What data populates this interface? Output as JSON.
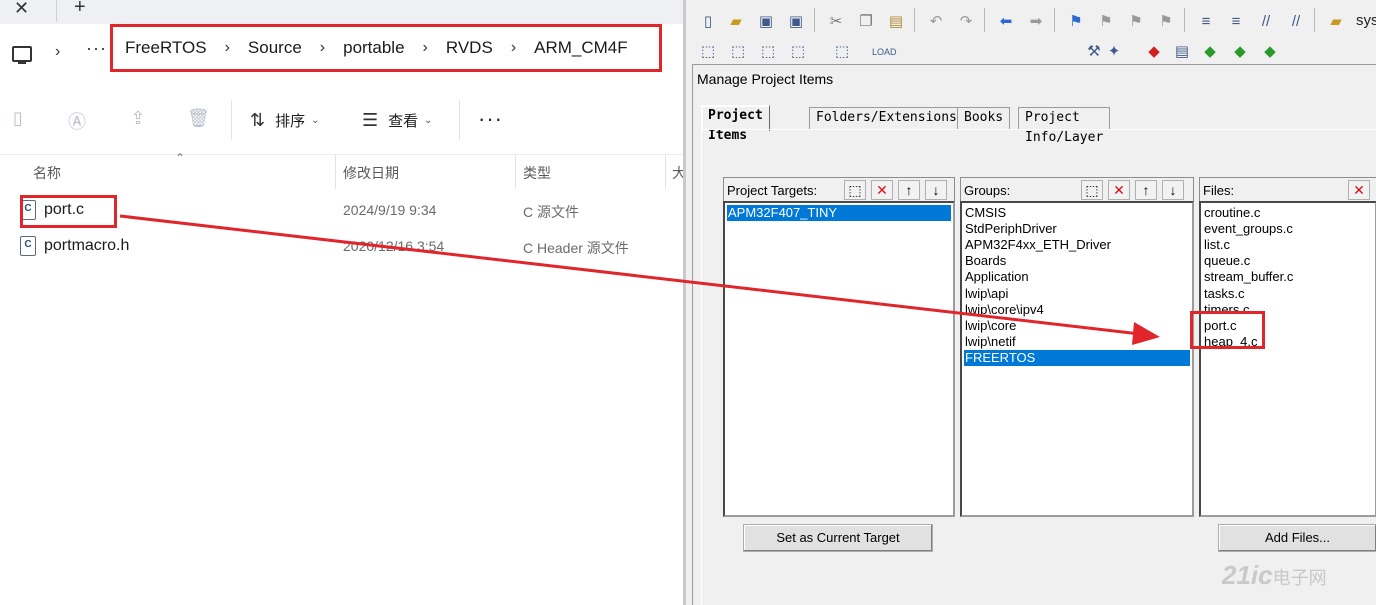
{
  "explorer": {
    "breadcrumbs": [
      "FreeRTOS",
      "Source",
      "portable",
      "RVDS",
      "ARM_CM4F"
    ],
    "toolbar": {
      "sort_label": "排序",
      "view_label": "查看"
    },
    "columns": {
      "name": "名称",
      "date": "修改日期",
      "type": "类型",
      "size": "大"
    },
    "files": [
      {
        "name": "port.c",
        "date": "2024/9/19 9:34",
        "type": "C 源文件"
      },
      {
        "name": "portmacro.h",
        "date": "2020/12/16 3:54",
        "type": "C Header 源文件"
      }
    ]
  },
  "keil": {
    "toolbar_partial_label": "sys",
    "dialog": {
      "title": "Manage Project Items",
      "tabs": [
        "Project Items",
        "Folders/Extensions",
        "Books",
        "Project Info/Layer"
      ],
      "targets": {
        "label": "Project Targets:",
        "items": [
          "APM32F407_TINY"
        ]
      },
      "groups": {
        "label": "Groups:",
        "items": [
          "CMSIS",
          "StdPeriphDriver",
          "APM32F4xx_ETH_Driver",
          "Boards",
          "Application",
          "lwip\\api",
          "lwip\\core\\ipv4",
          "lwip\\core",
          "lwip\\netif",
          "FREERTOS"
        ]
      },
      "files": {
        "label": "Files:",
        "items": [
          "croutine.c",
          "event_groups.c",
          "list.c",
          "queue.c",
          "stream_buffer.c",
          "tasks.c",
          "timers.c",
          "port.c",
          "heap_4.c"
        ]
      },
      "set_target_button": "Set as Current Target",
      "add_files_button": "Add Files..."
    }
  },
  "watermark": {
    "brand": "21ic",
    "sub": "电子网"
  },
  "colors": {
    "annotation_red": "#e0252b",
    "selection_blue": "#0078d7"
  }
}
